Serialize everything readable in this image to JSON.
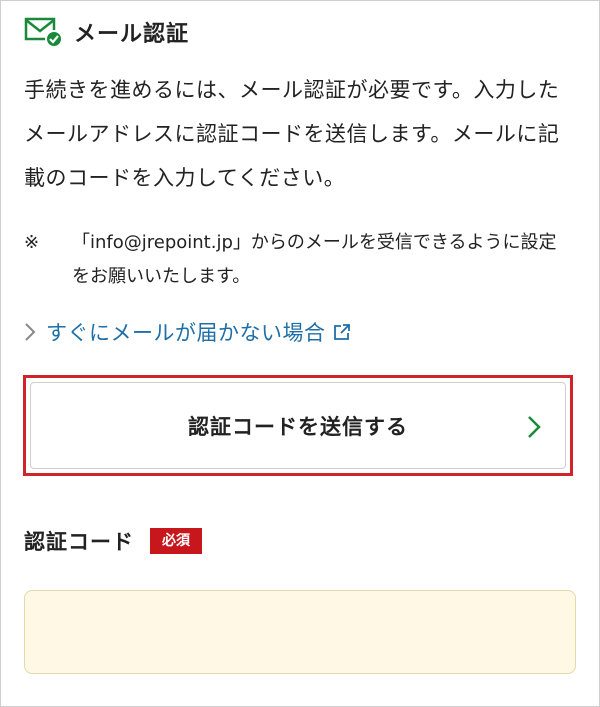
{
  "header": {
    "title": "メール認証"
  },
  "description": "手続きを進めるには、メール認証が必要です。入力したメールアドレスに認証コードを送信します。メールに記載のコードを入力してください。",
  "note": {
    "mark": "※",
    "text": "「info@jrepoint.jp」からのメールを受信できるように設定をお願いいたします。"
  },
  "help_link": {
    "label": "すぐにメールが届かない場合"
  },
  "send_button": {
    "label": "認証コードを送信する"
  },
  "code_field": {
    "label": "認証コード",
    "required_badge": "必須",
    "value": "",
    "placeholder": ""
  },
  "colors": {
    "accent_red": "#d0232a",
    "badge_red": "#c8161d",
    "link_blue": "#1f6fa8",
    "icon_green": "#1a8a3a",
    "input_bg": "#fff8e5"
  },
  "icons": {
    "mail": "mail-check-icon",
    "link_chevron": "chevron-right-icon",
    "external": "external-link-icon",
    "button_chevron": "chevron-right-icon"
  }
}
